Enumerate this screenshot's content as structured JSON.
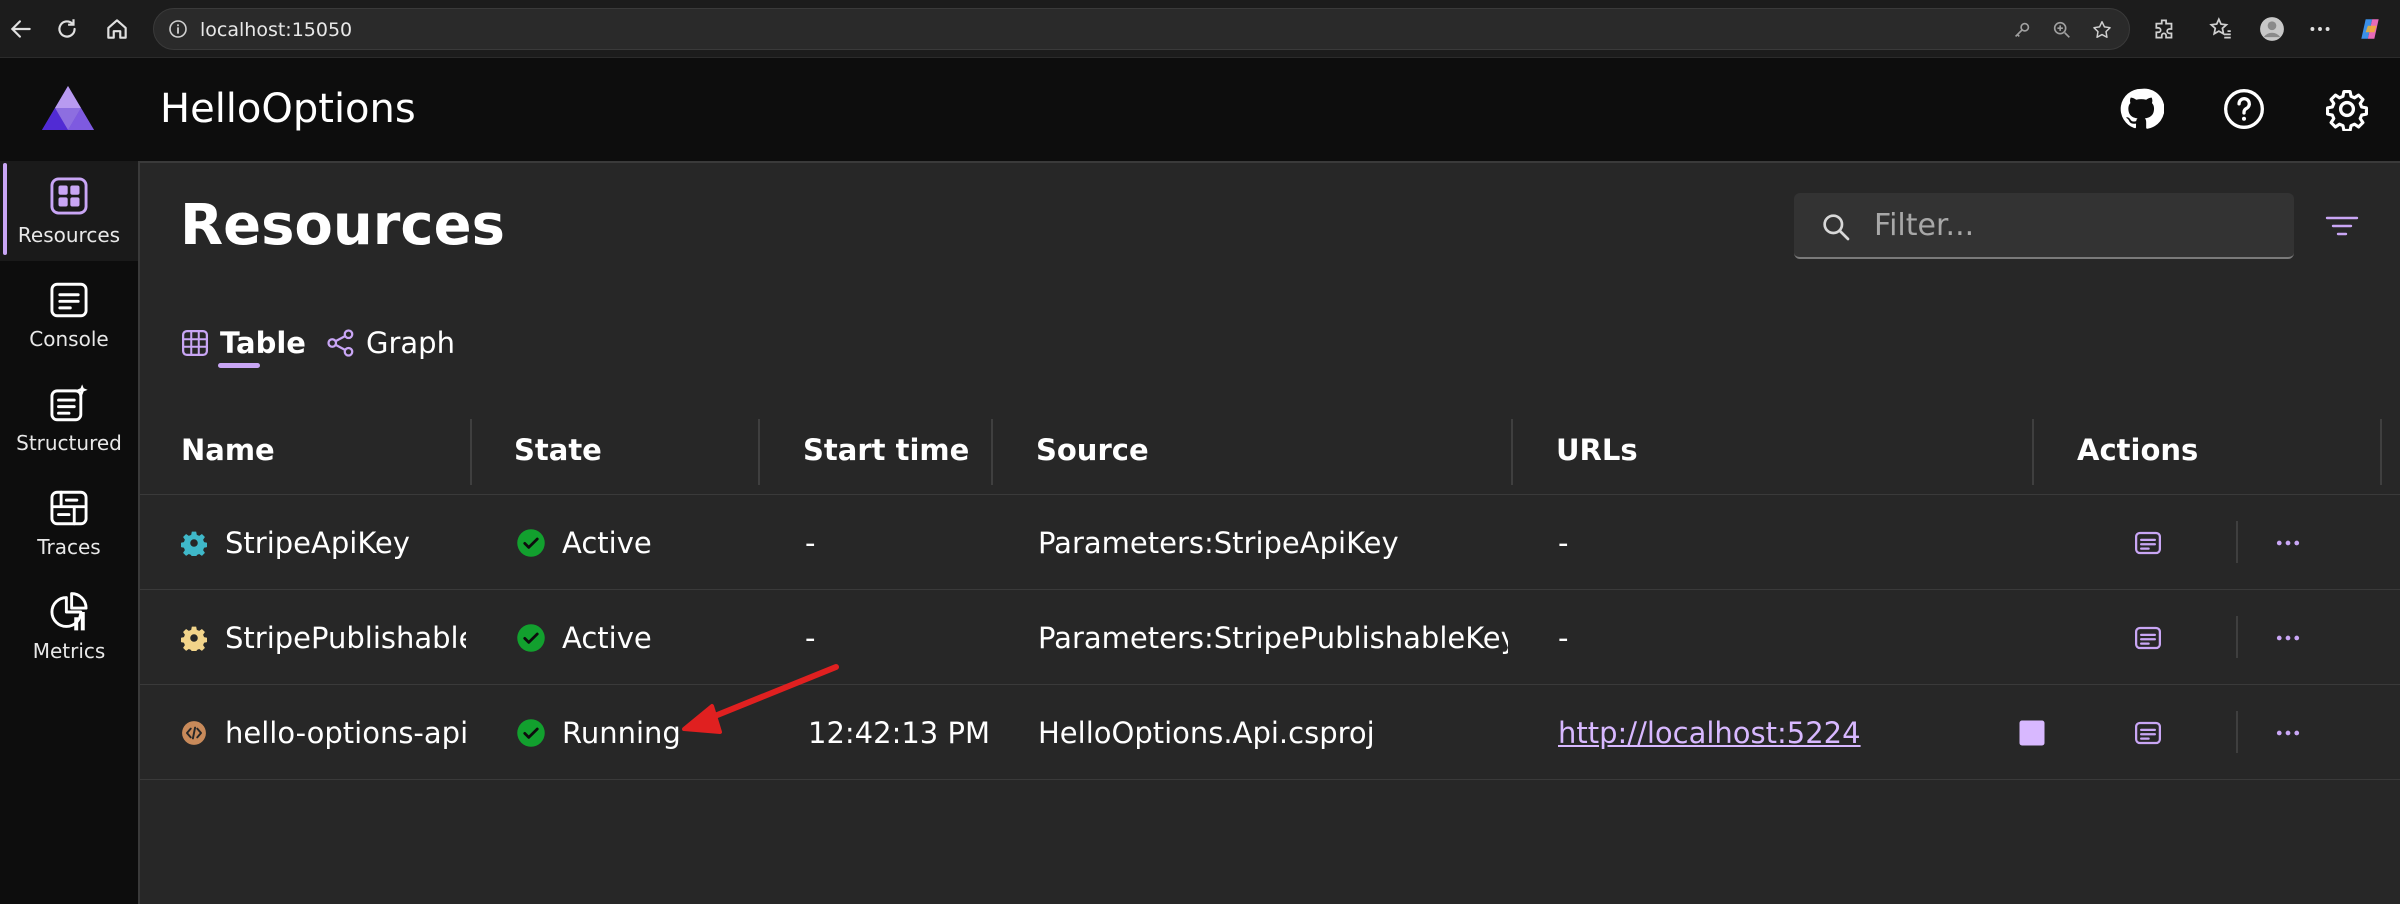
{
  "browser": {
    "url": "localhost:15050"
  },
  "app": {
    "title": "HelloOptions"
  },
  "nav": {
    "items": [
      {
        "label": "Resources",
        "icon": "resources-icon"
      },
      {
        "label": "Console",
        "icon": "console-icon"
      },
      {
        "label": "Structured",
        "icon": "structured-icon"
      },
      {
        "label": "Traces",
        "icon": "traces-icon"
      },
      {
        "label": "Metrics",
        "icon": "metrics-icon"
      }
    ]
  },
  "page": {
    "title": "Resources",
    "filter_placeholder": "Filter...",
    "tabs": [
      {
        "label": "Table",
        "icon": "table-icon"
      },
      {
        "label": "Graph",
        "icon": "graph-icon"
      }
    ]
  },
  "table": {
    "columns": [
      "Name",
      "State",
      "Start time",
      "Source",
      "URLs",
      "Actions"
    ],
    "rows": [
      {
        "name": "StripeApiKey",
        "state": "Active",
        "start_time": "-",
        "source": "Parameters:StripeApiKey",
        "url": "-",
        "icon_color": "#3fb8c9"
      },
      {
        "name": "StripePublishableKey",
        "state": "Active",
        "start_time": "-",
        "source": "Parameters:StripePublishableKey",
        "url": "-",
        "icon_color": "#f2d48a"
      },
      {
        "name": "hello-options-api",
        "state": "Running",
        "start_time": "12:42:13 PM",
        "source": "HelloOptions.Api.csproj",
        "url": "http://localhost:5224",
        "icon_color": "#c88a5a"
      }
    ]
  },
  "colors": {
    "accent": "#c9a6f5",
    "status_ok": "#12a02e",
    "annotation_arrow": "#e02020"
  }
}
